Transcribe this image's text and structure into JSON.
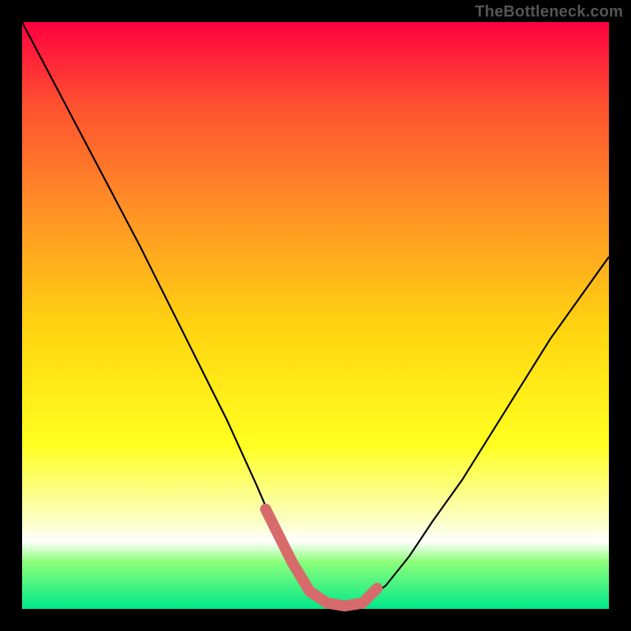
{
  "watermark": "TheBottleneck.com",
  "chart_data": {
    "type": "line",
    "title": "",
    "xlabel": "",
    "ylabel": "",
    "xlim": [
      0,
      100
    ],
    "ylim": [
      0,
      100
    ],
    "note": "x and y are normalized 0–100; axes are unlabeled in the image and values are estimated from pixel positions",
    "series": [
      {
        "name": "main-curve",
        "color": "#000000",
        "x": [
          0,
          5,
          10,
          15,
          20,
          25,
          30,
          35,
          40,
          43,
          46,
          49,
          52,
          55,
          58,
          62,
          66,
          70,
          75,
          80,
          85,
          90,
          95,
          100
        ],
        "y": [
          100,
          90.5,
          81,
          71.5,
          62,
          52,
          42,
          32,
          21,
          14,
          8,
          3,
          1,
          0.5,
          1,
          4,
          9,
          15,
          22,
          30,
          38,
          46,
          53,
          60
        ]
      },
      {
        "name": "plateau-highlight",
        "color": "#d76b6b",
        "x": [
          41.5,
          43,
          46,
          49,
          52,
          55,
          58,
          60.5
        ],
        "y": [
          17,
          14,
          8,
          3,
          1,
          0.5,
          1,
          3.5
        ]
      }
    ],
    "background_gradient": {
      "top": "#ff0040",
      "upper_mid_1": "#ff5030",
      "upper_mid_2": "#ff9425",
      "mid": "#ffd410",
      "lower_mid": "#ffff20",
      "pale_band": "#fbffc4",
      "bottom_1": "#8cff7a",
      "bottom_2": "#00e88a"
    },
    "plot_area_border": "#000000"
  }
}
